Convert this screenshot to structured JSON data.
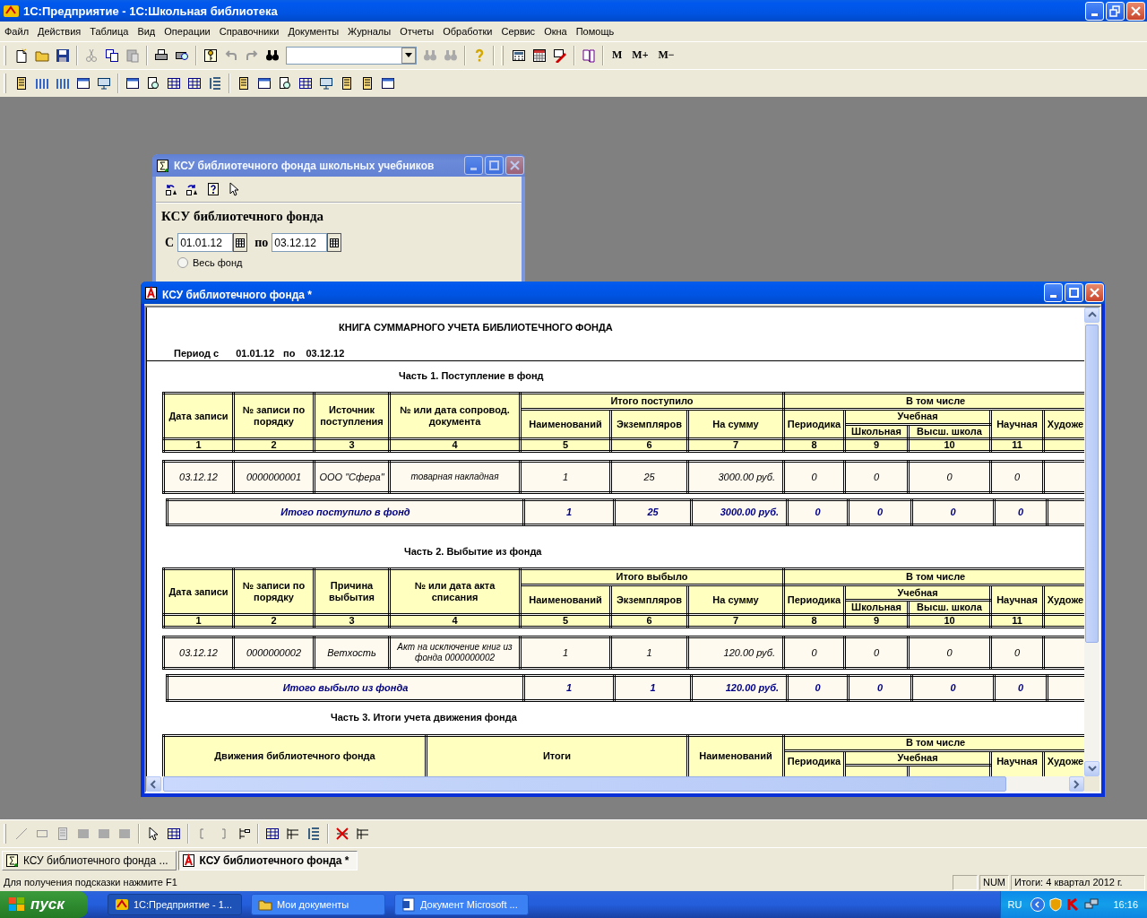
{
  "app": {
    "title": "1С:Предприятие - 1С:Школьная библиотека"
  },
  "menu": [
    "Файл",
    "Действия",
    "Таблица",
    "Вид",
    "Операции",
    "Справочники",
    "Документы",
    "Журналы",
    "Отчеты",
    "Обработки",
    "Сервис",
    "Окна",
    "Помощь"
  ],
  "memory_buttons": [
    "M",
    "M+",
    "M−"
  ],
  "dialog": {
    "title": "КСУ библиотечного фонда школьных учебников",
    "active": false,
    "heading": "КСУ библиотечного фонда",
    "from_label": "С",
    "from": "01.01.12",
    "to_label": "по",
    "to": "03.12.12",
    "radio": {
      "label": "Весь фонд",
      "selected": false
    }
  },
  "report": {
    "title": "КСУ библиотечного фонда  *",
    "active": true,
    "heading": "КНИГА СУММАРНОГО УЧЕТА БИБЛИОТЕЧНОГО ФОНДА",
    "period": [
      "Период с",
      "01.01.12",
      "по",
      "03.12.12"
    ],
    "parts": [
      {
        "title": "Часть 1. Поступление в фонд",
        "columns": [
          "Дата записи",
          "№ записи по порядку",
          "Источник поступления",
          "№ или дата сопровод. документа"
        ],
        "group": "Итого поступило",
        "group_columns": [
          "Наименований",
          "Экземпляров",
          "На сумму"
        ],
        "included": "В том числе",
        "periodicals": "Периодика",
        "educational": "Учебная",
        "educational_columns": [
          "Школьная",
          "Высш. школа"
        ],
        "scientific": "Научная",
        "column_12": "Художе",
        "numbers": [
          "1",
          "2",
          "3",
          "4",
          "5",
          "6",
          "7",
          "8",
          "9",
          "10",
          "11"
        ],
        "rows": [
          {
            "cells": [
              "03.12.12",
              "0000000001",
              "ООО \"Сфера\"",
              "товарная накладная",
              "1",
              "25",
              "3000.00 руб.",
              "0",
              "0",
              "0",
              "0"
            ]
          }
        ],
        "total": {
          "label": "Итого поступило в фонд",
          "values": [
            "1",
            "25",
            "3000.00 руб.",
            "0",
            "0",
            "0",
            "0"
          ]
        }
      },
      {
        "title": "Часть 2. Выбытие из фонда",
        "columns": [
          "Дата записи",
          "№ записи по порядку",
          "Причина выбытия",
          "№ или дата акта списания"
        ],
        "group": "Итого выбыло",
        "group_columns": [
          "Наименований",
          "Экземпляров",
          "На сумму"
        ],
        "included": "В том числе",
        "periodicals": "Периодика",
        "educational": "Учебная",
        "educational_columns": [
          "Школьная",
          "Высш. школа"
        ],
        "scientific": "Научная",
        "column_12": "Художе",
        "numbers": [
          "1",
          "2",
          "3",
          "4",
          "5",
          "6",
          "7",
          "8",
          "9",
          "10",
          "11"
        ],
        "rows": [
          {
            "cells": [
              "03.12.12",
              "0000000002",
              "Ветхость",
              "Акт на исключение книг из фонда 0000000002",
              "1",
              "1",
              "120.00 руб.",
              "0",
              "0",
              "0",
              "0"
            ]
          }
        ],
        "total": {
          "label": "Итого выбыло из фонда",
          "values": [
            "1",
            "1",
            "120.00 руб.",
            "0",
            "0",
            "0",
            "0"
          ]
        }
      }
    ],
    "part_3": {
      "title": "Часть 3. Итоги учета движения фонда",
      "columns": [
        "Движения библиотечного фонда",
        "Итоги",
        "Наименований"
      ],
      "included": "В том числе",
      "periodicals": "Периодика",
      "educational": "Учебная",
      "scientific": "Научная",
      "column_12": "Художе"
    }
  },
  "window_tabs": [
    {
      "label": "КСУ библиотечного фонда ...",
      "kind": "form",
      "selected": false
    },
    {
      "label": "КСУ библиотечного фонда  *",
      "kind": "report",
      "selected": true
    }
  ],
  "status_bar": {
    "hint": "Для получения подсказки нажмите F1",
    "num": "NUM",
    "period": "Итоги: 4 квартал 2012 г."
  },
  "taskbar": {
    "start": "пуск",
    "tasks": [
      {
        "label": "1С:Предприятие - 1...",
        "kind": "app",
        "selected": true
      },
      {
        "label": "Мои документы",
        "kind": "folder",
        "selected": false
      },
      {
        "label": "Документ Microsoft ...",
        "kind": "document",
        "selected": false
      }
    ],
    "language": "RU",
    "time": "16:16"
  }
}
